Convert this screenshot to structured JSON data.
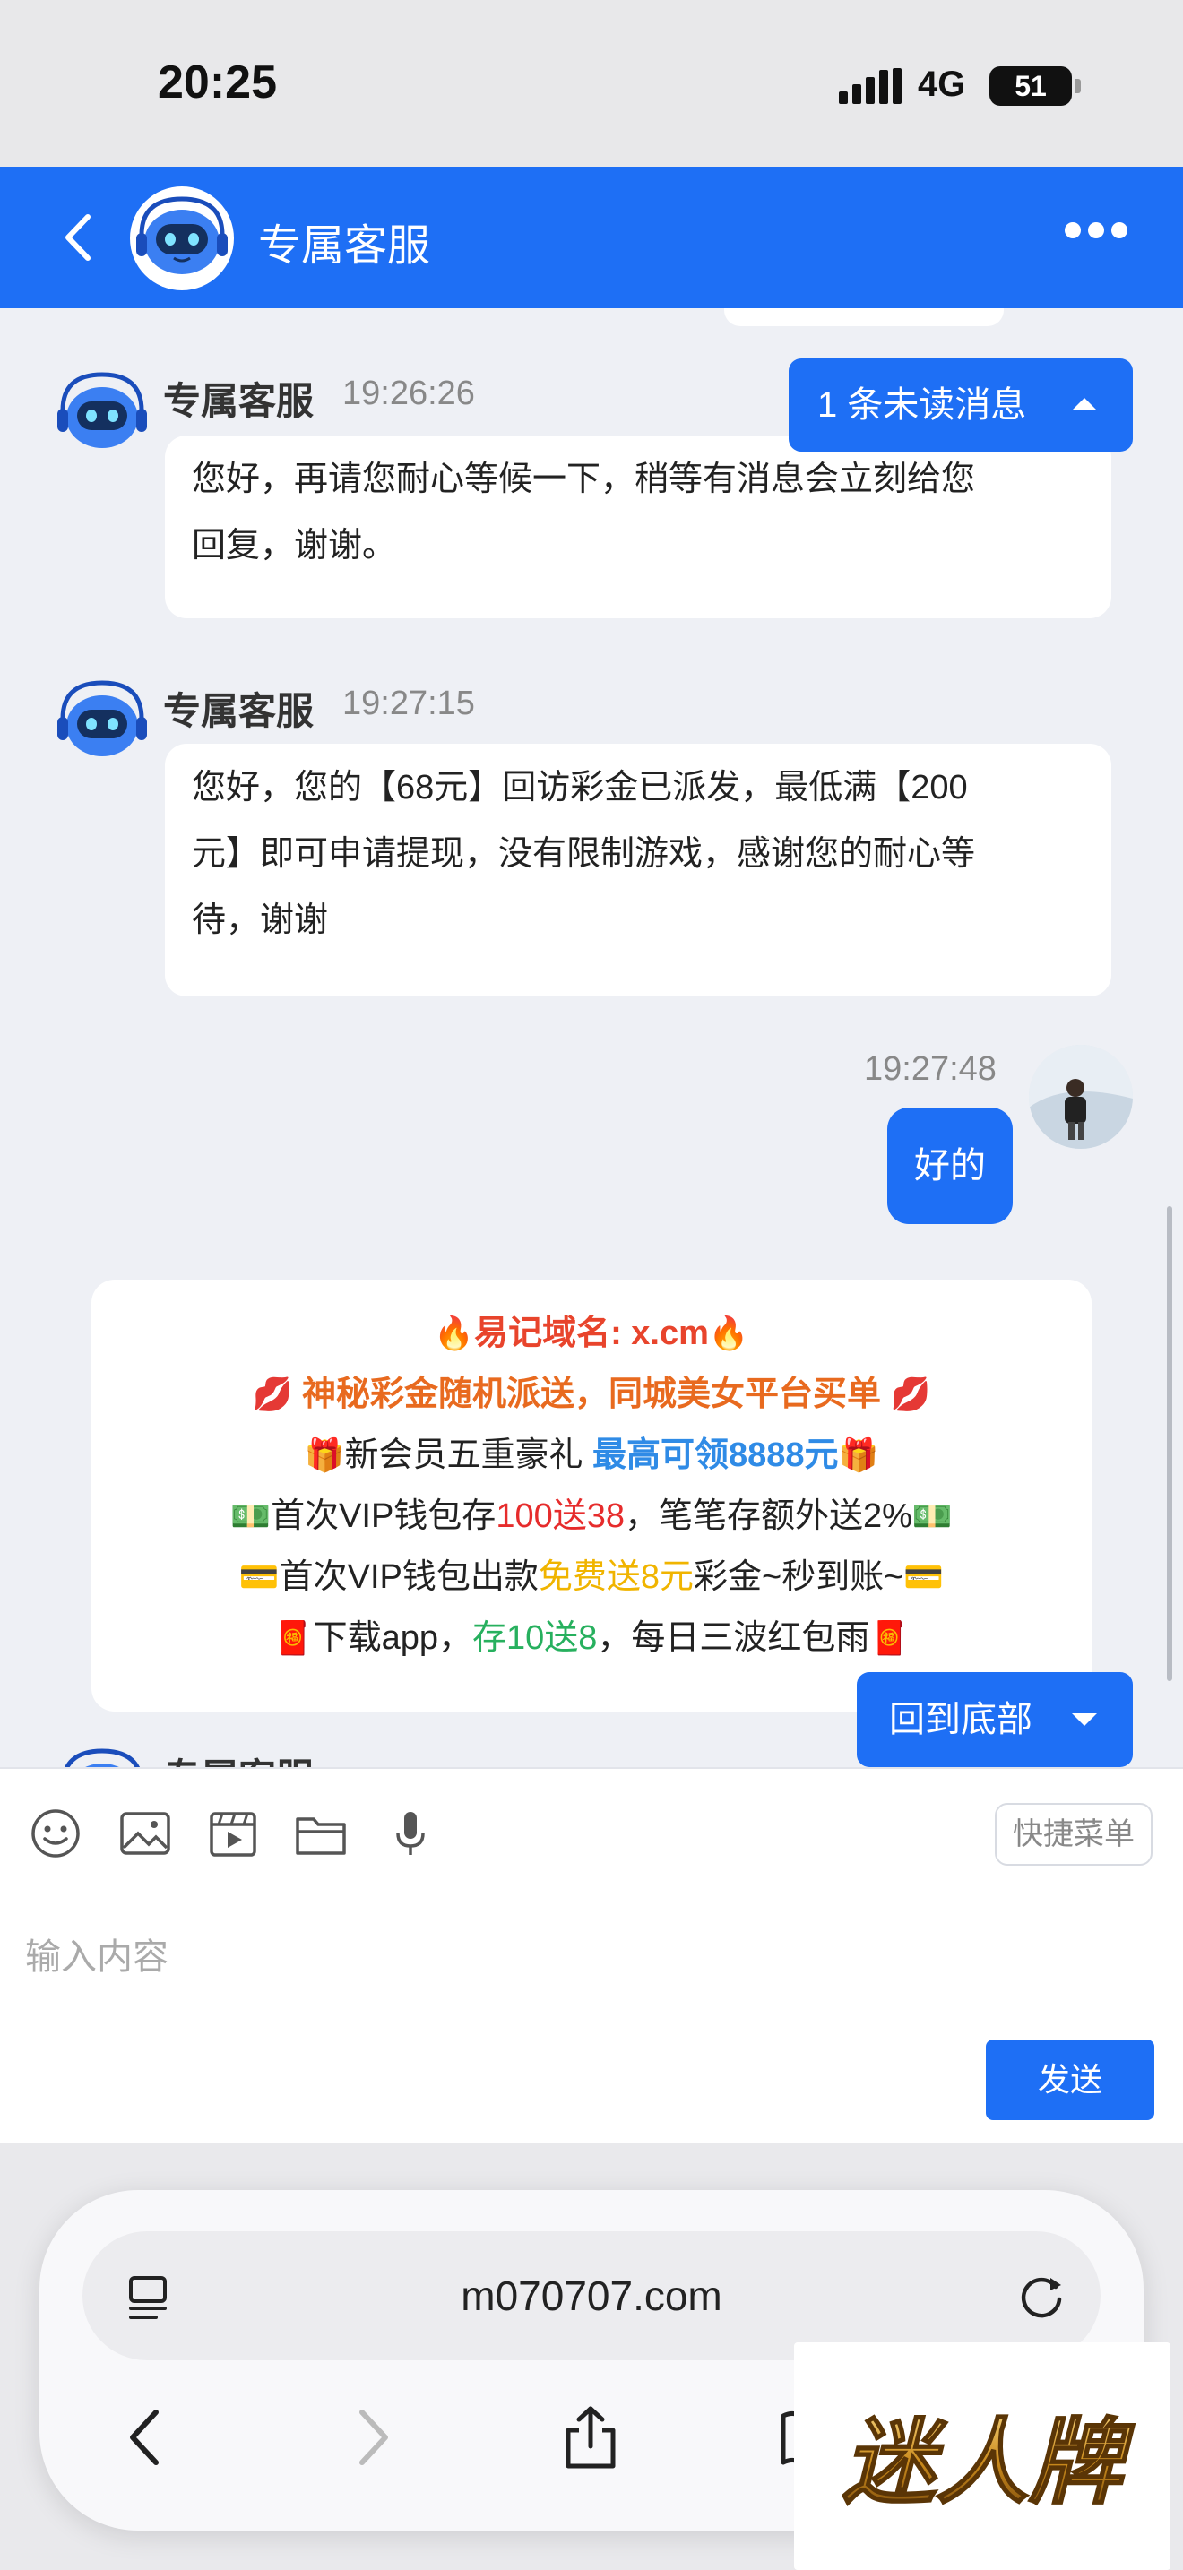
{
  "status_bar": {
    "time": "20:25",
    "network": "4G",
    "battery": "51"
  },
  "header": {
    "title": "专属客服"
  },
  "messages": [
    {
      "sender": "专属客服",
      "time": "19:26:26",
      "lines": [
        "您好，再请您耐心等候一下，稍等有消息会立刻给您",
        "回复，谢谢。"
      ]
    },
    {
      "sender": "专属客服",
      "time": "19:27:15",
      "lines": [
        "您好，您的【68元】回访彩金已派发，最低满【200",
        "元】即可申请提现，没有限制游戏，感谢您的耐心等",
        "待，谢谢"
      ]
    }
  ],
  "my_message": {
    "time": "19:27:48",
    "text": "好的"
  },
  "unread_pill": {
    "label": "1 条未读消息"
  },
  "to_bottom_pill": {
    "label": "回到底部"
  },
  "partial_sender": "专属客服",
  "promo": {
    "line1": "易记域名: x.cm",
    "line2": "神秘彩金随机派送，同城美女平台买单",
    "line3_a": "新会员五重豪礼 ",
    "line3_b": "最高可领8888元",
    "line4_a": "首次VIP钱包存",
    "line4_b": "100送38",
    "line4_c": "，笔笔存额外送2%",
    "line5_a": "首次VIP钱包出款",
    "line5_b": "免费送8元",
    "line5_c": "彩金~秒到账~",
    "line6_a": "下载app，",
    "line6_b": "存10送8",
    "line6_c": "，每日三波红包雨"
  },
  "composer": {
    "quick_menu": "快捷菜单",
    "placeholder": "输入内容",
    "send": "发送"
  },
  "browser": {
    "url": "m070707.com"
  },
  "watermark": {
    "text": "迷人牌"
  },
  "icons": [
    "back-icon",
    "more-icon",
    "emoji-icon",
    "image-icon",
    "video-icon",
    "folder-icon",
    "microphone-icon",
    "tabs-icon",
    "reload-icon",
    "share-icon",
    "bookmarks-icon"
  ],
  "colors": {
    "brand_blue": "#1e6ff5",
    "background": "#eef0f5"
  }
}
